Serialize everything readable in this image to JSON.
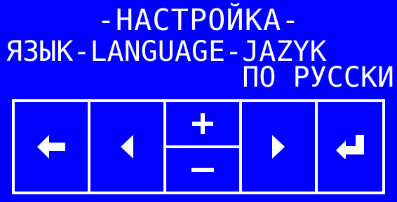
{
  "screen": {
    "title": "-НАСТРОЙКА-",
    "setting_label": "ЯЗЫК-LANGUAGE-JAZYK",
    "current_value": "ПО РУССКИ"
  },
  "keypad": {
    "keys": [
      {
        "name": "back-key",
        "icon": "arrow-left-icon"
      },
      {
        "name": "left-key",
        "icon": "triangle-left-icon"
      },
      {
        "name": "plus-key",
        "icon": "plus-icon"
      },
      {
        "name": "minus-key",
        "icon": "minus-icon"
      },
      {
        "name": "right-key",
        "icon": "triangle-right-icon"
      },
      {
        "name": "enter-key",
        "icon": "enter-arrow-icon"
      }
    ]
  },
  "colors": {
    "background": "#0000ff",
    "foreground": "#ffffff"
  }
}
